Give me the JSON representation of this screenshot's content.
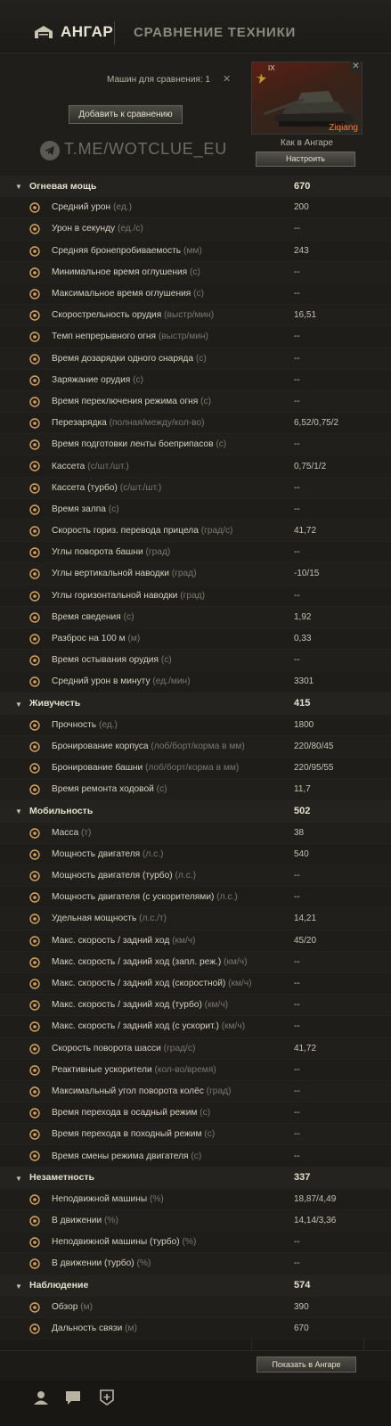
{
  "nav": {
    "hangar": "АНГАР",
    "compare": "СРАВНЕНИЕ ТЕХНИКИ"
  },
  "compare": {
    "count_label": "Машин для сравнения: 1",
    "clear_icon": "close-icon",
    "add_button": "Добавить к сравнению",
    "watermark": "T.ME/WOTCLUE_EU"
  },
  "tank": {
    "tier": "IX",
    "name": "Ziqiang",
    "config_label": "Как в Ангаре",
    "setup_button": "Настроить"
  },
  "rows": [
    {
      "type": "section",
      "label": "Огневая мощь",
      "value": "670"
    },
    {
      "label": "Средний урон",
      "unit": "(ед.)",
      "value": "200",
      "icon": "damage-icon"
    },
    {
      "label": "Урон в секунду",
      "unit": "(ед./с)",
      "value": "--",
      "icon": "dps-icon"
    },
    {
      "label": "Средняя бронепробиваемость",
      "unit": "(мм)",
      "value": "243",
      "icon": "penetration-icon"
    },
    {
      "label": "Минимальное время оглушения",
      "unit": "(с)",
      "value": "--",
      "icon": "stun-icon"
    },
    {
      "label": "Максимальное время оглушения",
      "unit": "(с)",
      "value": "--",
      "icon": "stun-icon"
    },
    {
      "label": "Скорострельность орудия",
      "unit": "(выстр/мин)",
      "value": "16,51",
      "icon": "rate-of-fire-icon"
    },
    {
      "label": "Темп непрерывного огня",
      "unit": "(выстр/мин)",
      "value": "--",
      "icon": "continuous-fire-icon"
    },
    {
      "label": "Время дозарядки одного снаряда",
      "unit": "(с)",
      "value": "--",
      "icon": "shell-reload-icon"
    },
    {
      "label": "Заряжание орудия",
      "unit": "(с)",
      "value": "--",
      "icon": "charge-icon"
    },
    {
      "label": "Время переключения режима огня",
      "unit": "(с)",
      "value": "--",
      "icon": "fire-mode-icon"
    },
    {
      "label": "Перезарядка",
      "unit": "(полная/между/кол-во)",
      "value": "6,52/0,75/2",
      "icon": "reload-icon"
    },
    {
      "label": "Время подготовки ленты боеприпасов",
      "unit": "(с)",
      "value": "--",
      "icon": "ammo-belt-icon"
    },
    {
      "label": "Кассета",
      "unit": "(с/шт./шт.)",
      "value": "0,75/1/2",
      "icon": "magazine-icon"
    },
    {
      "label": "Кассета (турбо)",
      "unit": "(с/шт./шт.)",
      "value": "--",
      "icon": "magazine-turbo-icon"
    },
    {
      "label": "Время залпа",
      "unit": "(с)",
      "value": "--",
      "icon": "salvo-icon"
    },
    {
      "label": "Скорость гориз. перевода прицела",
      "unit": "(град/с)",
      "value": "41,72",
      "icon": "traverse-icon"
    },
    {
      "label": "Углы поворота башни",
      "unit": "(град)",
      "value": "--",
      "icon": "turret-angle-icon"
    },
    {
      "label": "Углы вертикальной наводки",
      "unit": "(град)",
      "value": "-10/15",
      "icon": "elevation-icon"
    },
    {
      "label": "Углы горизонтальной наводки",
      "unit": "(град)",
      "value": "--",
      "icon": "horizontal-aim-icon"
    },
    {
      "label": "Время сведения",
      "unit": "(с)",
      "value": "1,92",
      "icon": "aim-time-icon"
    },
    {
      "label": "Разброс на 100 м",
      "unit": "(м)",
      "value": "0,33",
      "icon": "dispersion-icon"
    },
    {
      "label": "Время остывания орудия",
      "unit": "(с)",
      "value": "--",
      "icon": "cooling-icon"
    },
    {
      "label": "Средний урон в минуту",
      "unit": "(ед./мин)",
      "value": "3301",
      "icon": "dpm-icon"
    },
    {
      "type": "section",
      "label": "Живучесть",
      "value": "415"
    },
    {
      "label": "Прочность",
      "unit": "(ед.)",
      "value": "1800",
      "icon": "hp-icon"
    },
    {
      "label": "Бронирование корпуса",
      "unit": "(лоб/борт/корма в мм)",
      "value": "220/80/45",
      "icon": "hull-armor-icon"
    },
    {
      "label": "Бронирование башни",
      "unit": "(лоб/борт/корма в мм)",
      "value": "220/95/55",
      "icon": "turret-armor-icon"
    },
    {
      "label": "Время ремонта ходовой",
      "unit": "(с)",
      "value": "11,7",
      "icon": "repair-icon"
    },
    {
      "type": "section",
      "label": "Мобильность",
      "value": "502"
    },
    {
      "label": "Масса",
      "unit": "(т)",
      "value": "38",
      "icon": "weight-icon"
    },
    {
      "label": "Мощность двигателя",
      "unit": "(л.с.)",
      "value": "540",
      "icon": "engine-icon"
    },
    {
      "label": "Мощность двигателя (турбо)",
      "unit": "(л.с.)",
      "value": "--",
      "icon": "engine-turbo-icon"
    },
    {
      "label": "Мощность двигателя (с ускорителями)",
      "unit": "(л.с.)",
      "value": "--",
      "icon": "engine-boost-icon"
    },
    {
      "label": "Удельная мощность",
      "unit": "(л.с./т)",
      "value": "14,21",
      "icon": "power-ratio-icon"
    },
    {
      "label": "Макс. скорость / задний ход",
      "unit": "(км/ч)",
      "value": "45/20",
      "icon": "speed-icon"
    },
    {
      "label": "Макс. скорость / задний ход (запл. реж.)",
      "unit": "(км/ч)",
      "value": "--",
      "icon": "speed-icon"
    },
    {
      "label": "Макс. скорость / задний ход (скоростной)",
      "unit": "(км/ч)",
      "value": "--",
      "icon": "speed-icon"
    },
    {
      "label": "Макс. скорость / задний ход (турбо)",
      "unit": "(км/ч)",
      "value": "--",
      "icon": "speed-icon"
    },
    {
      "label": "Макс. скорость / задний ход (с ускорит.)",
      "unit": "(км/ч)",
      "value": "--",
      "icon": "speed-icon"
    },
    {
      "label": "Скорость поворота шасси",
      "unit": "(град/с)",
      "value": "41,72",
      "icon": "hull-traverse-icon"
    },
    {
      "label": "Реактивные ускорители",
      "unit": "(кол-во/время)",
      "value": "--",
      "icon": "rocket-booster-icon"
    },
    {
      "label": "Максимальный угол поворота колёс",
      "unit": "(град)",
      "value": "--",
      "icon": "wheel-angle-icon"
    },
    {
      "label": "Время перехода в осадный режим",
      "unit": "(с)",
      "value": "--",
      "icon": "siege-mode-icon"
    },
    {
      "label": "Время перехода в походный режим",
      "unit": "(с)",
      "value": "--",
      "icon": "travel-mode-icon"
    },
    {
      "label": "Время смены режима двигателя",
      "unit": "(с)",
      "value": "--",
      "icon": "engine-mode-icon"
    },
    {
      "type": "section",
      "label": "Незаметность",
      "value": "337"
    },
    {
      "label": "Неподвижной машины",
      "unit": "(%)",
      "value": "18,87/4,49",
      "icon": "camo-stationary-icon"
    },
    {
      "label": "В движении",
      "unit": "(%)",
      "value": "14,14/3,36",
      "icon": "camo-moving-icon"
    },
    {
      "label": "Неподвижной машины (турбо)",
      "unit": "(%)",
      "value": "--",
      "icon": "camo-stationary-icon"
    },
    {
      "label": "В движении (турбо)",
      "unit": "(%)",
      "value": "--",
      "icon": "camo-moving-icon"
    },
    {
      "type": "section",
      "label": "Наблюдение",
      "value": "574"
    },
    {
      "label": "Обзор",
      "unit": "(м)",
      "value": "390",
      "icon": "view-range-icon"
    },
    {
      "label": "Дальность связи",
      "unit": "(м)",
      "value": "670",
      "icon": "radio-range-icon"
    }
  ],
  "footer": {
    "show_button": "Показать в Ангаре"
  },
  "bottom_icons": [
    "profile-icon",
    "chat-icon",
    "clan-icon"
  ],
  "colors": {
    "accent": "#d8a25a",
    "tank_name": "#ff7a2a",
    "background": "#1b1a17"
  }
}
